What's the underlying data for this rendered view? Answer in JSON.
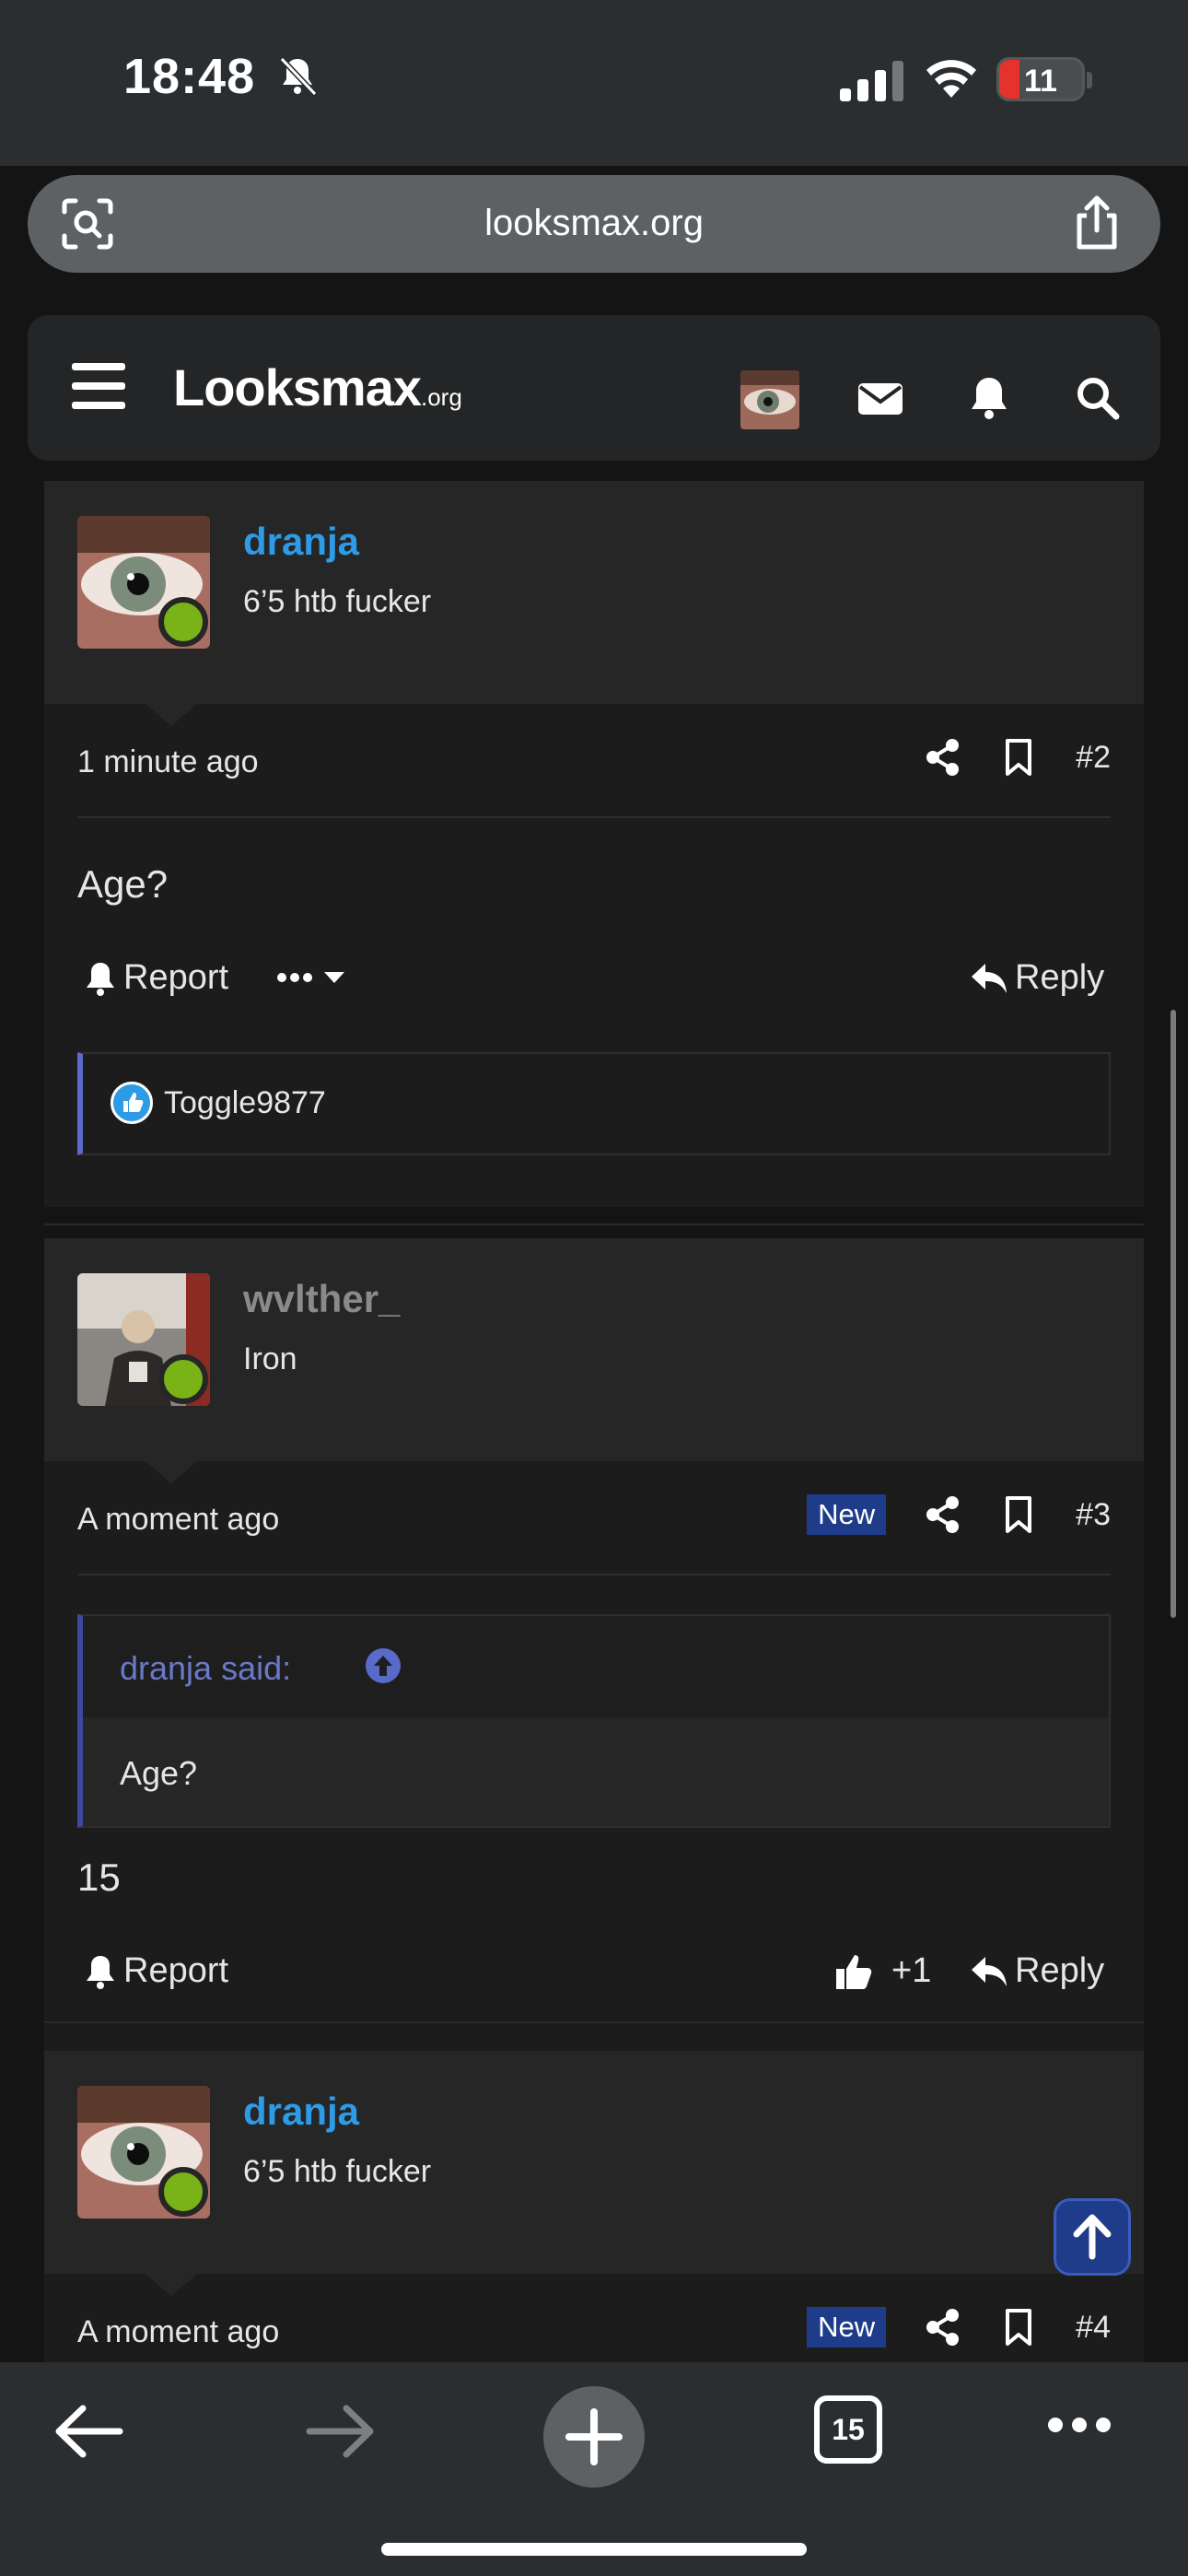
{
  "status_bar": {
    "time": "18:48",
    "battery": "11"
  },
  "url_bar": {
    "url": "looksmax.org"
  },
  "site_header": {
    "logo": "Looksmax",
    "logo_suffix": ".org",
    "icons": [
      "avatar",
      "envelope-icon",
      "bell-icon",
      "search-icon"
    ]
  },
  "posts": [
    {
      "username": "dranja",
      "user_title": "6’5 htb fucker",
      "time": "1 minute ago",
      "post_number": "#2",
      "new_badge": "",
      "body": "Age?",
      "report_label": "Report",
      "reply_label": "Reply",
      "reaction_user": "Toggle9877"
    },
    {
      "username": "wvlther_",
      "user_title": "Iron",
      "time": "A moment ago",
      "post_number": "#3",
      "new_badge": "New",
      "quote_author": "dranja said:",
      "quote_text": "Age?",
      "body": "15",
      "report_label": "Report",
      "like_label": "+1",
      "reply_label": "Reply"
    },
    {
      "username": "dranja",
      "user_title": "6’5 htb fucker",
      "time": "A moment ago",
      "post_number": "#4",
      "new_badge": "New"
    }
  ],
  "bottom_bar": {
    "tab_count": "15"
  },
  "colors": {
    "username_blue": "#2d9be6",
    "online_green": "#7ab317",
    "badge_blue": "#1f3c8a"
  }
}
